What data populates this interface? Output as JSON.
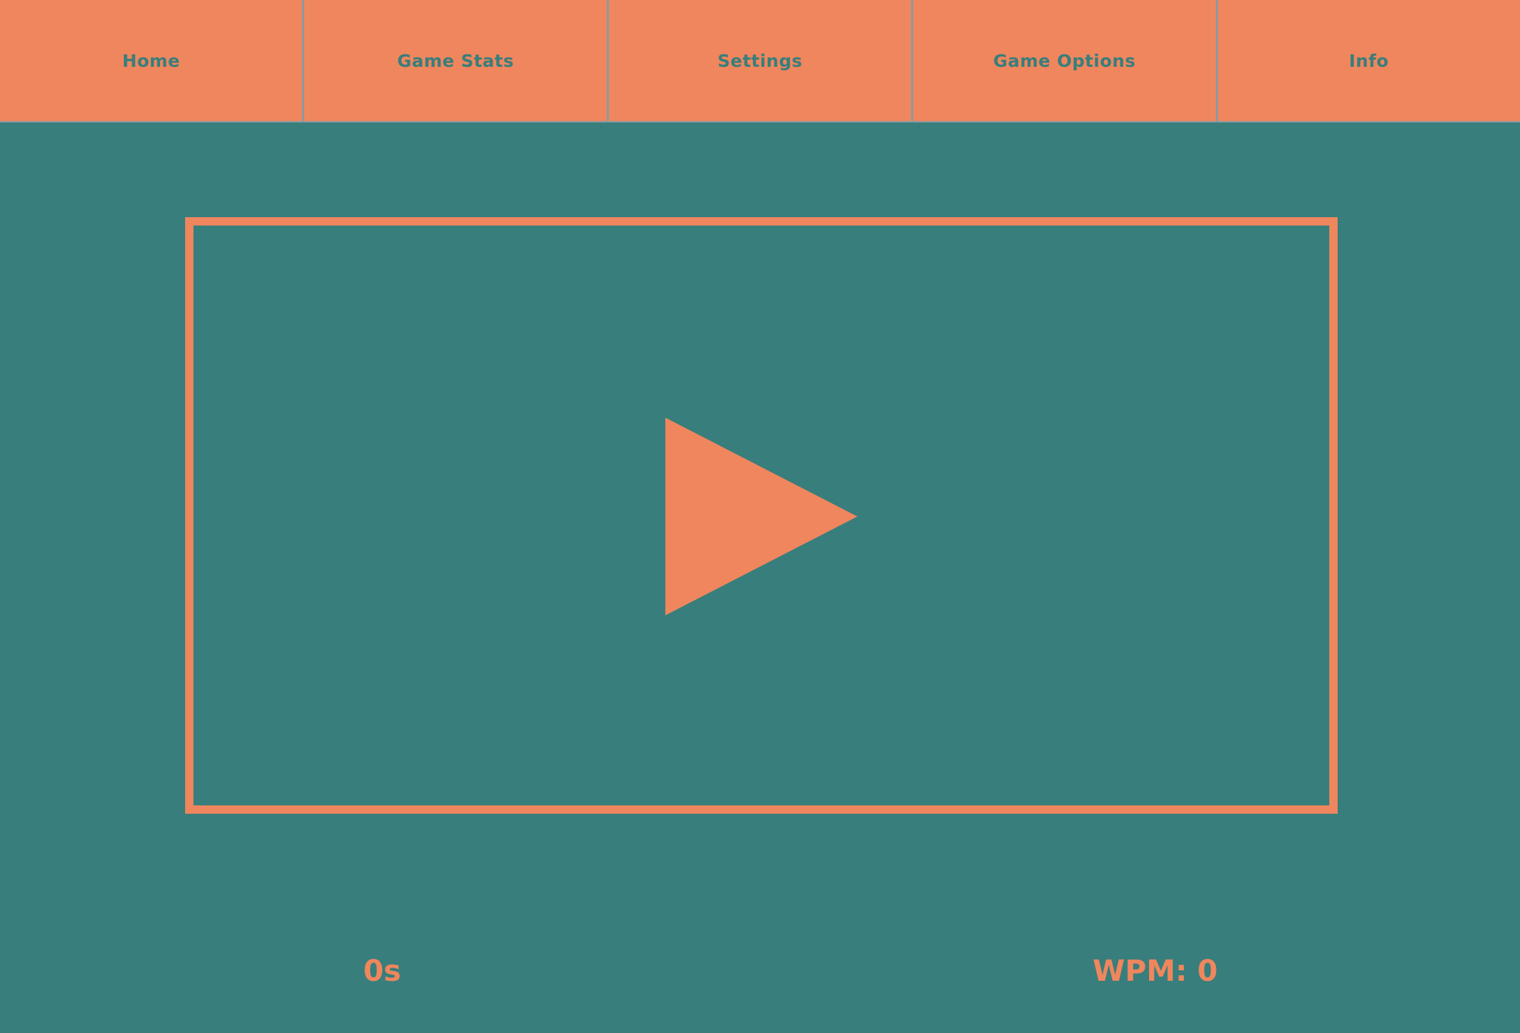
{
  "nav": {
    "items": [
      {
        "label": "Home"
      },
      {
        "label": "Game Stats"
      },
      {
        "label": "Settings"
      },
      {
        "label": "Game Options"
      },
      {
        "label": "Info"
      }
    ]
  },
  "game": {
    "play_icon": "play-icon",
    "timer": "0s",
    "wpm_label": "WPM:",
    "wpm_value": "0"
  },
  "colors": {
    "background": "#387e7c",
    "accent": "#ef865d"
  }
}
